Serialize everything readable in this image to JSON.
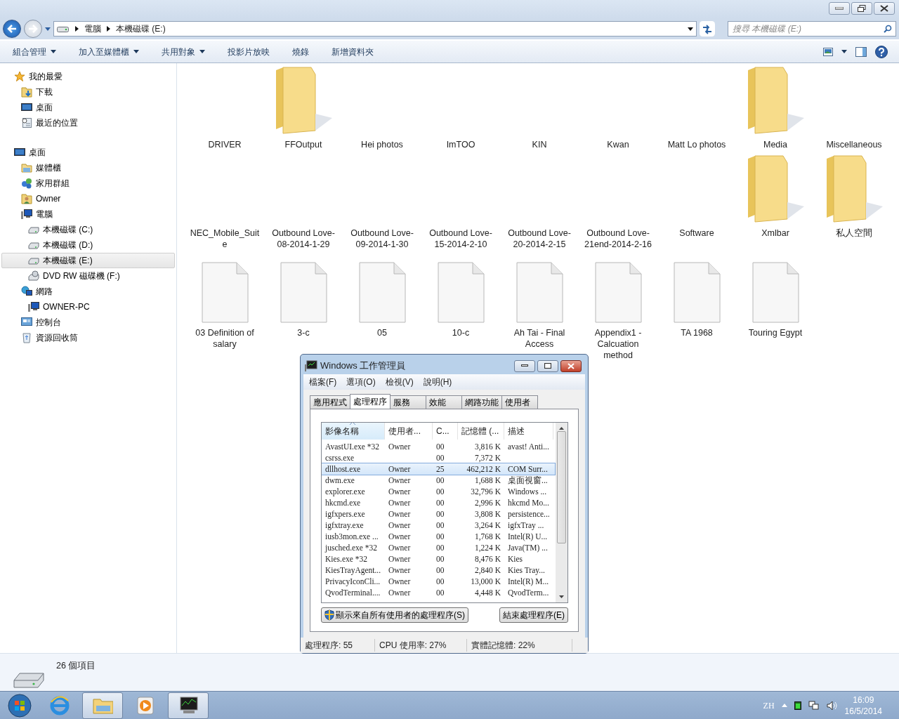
{
  "address_bar": {
    "path": [
      "電腦",
      "本機磁碟 (E:)"
    ]
  },
  "search": {
    "placeholder": "搜尋 本機磁碟 (E:)"
  },
  "toolbar": [
    {
      "label": "組合管理",
      "dropdown": true
    },
    {
      "label": "加入至媒體櫃",
      "dropdown": true
    },
    {
      "label": "共用對象",
      "dropdown": true
    },
    {
      "label": "投影片放映",
      "dropdown": false
    },
    {
      "label": "燒錄",
      "dropdown": false
    },
    {
      "label": "新增資料夾",
      "dropdown": false
    }
  ],
  "sidebar": {
    "items": [
      {
        "label": "我的最愛",
        "kind": "star",
        "selected": false,
        "children": [
          {
            "label": "下載",
            "kind": "download",
            "selected": false
          },
          {
            "label": "桌面",
            "kind": "desktop",
            "selected": false
          },
          {
            "label": "最近的位置",
            "kind": "recent",
            "selected": false
          }
        ]
      },
      {
        "label": "桌面",
        "kind": "desktop",
        "selected": false,
        "children": [
          {
            "label": "媒體櫃",
            "kind": "library",
            "selected": false
          },
          {
            "label": "家用群組",
            "kind": "homegroup",
            "selected": false
          },
          {
            "label": "Owner",
            "kind": "user",
            "selected": false
          },
          {
            "label": "電腦",
            "kind": "computer",
            "selected": false,
            "children": [
              {
                "label": "本機磁碟 (C:)",
                "kind": "drive",
                "selected": false
              },
              {
                "label": "本機磁碟 (D:)",
                "kind": "drive",
                "selected": false
              },
              {
                "label": "本機磁碟 (E:)",
                "kind": "drive",
                "selected": true
              },
              {
                "label": "DVD RW 磁碟機 (F:)",
                "kind": "dvd",
                "selected": false
              }
            ]
          },
          {
            "label": "網路",
            "kind": "network",
            "selected": false,
            "children": [
              {
                "label": "OWNER-PC",
                "kind": "computer",
                "selected": false
              }
            ]
          },
          {
            "label": "控制台",
            "kind": "control",
            "selected": false
          },
          {
            "label": "資源回收筒",
            "kind": "recycle",
            "selected": false
          }
        ]
      }
    ]
  },
  "files": [
    {
      "name": "DRIVER",
      "kind": "blank"
    },
    {
      "name": "FFOutput",
      "kind": "folder"
    },
    {
      "name": "Hei photos",
      "kind": "blank"
    },
    {
      "name": "ImTOO",
      "kind": "blank"
    },
    {
      "name": "KIN",
      "kind": "blank"
    },
    {
      "name": "Kwan",
      "kind": "blank"
    },
    {
      "name": "Matt Lo photos",
      "kind": "blank"
    },
    {
      "name": "Media",
      "kind": "folder"
    },
    {
      "name": "Miscellaneous",
      "kind": "blank"
    },
    {
      "name": "NEC_Mobile_Suite",
      "kind": "blank"
    },
    {
      "name": "Outbound Love-08-2014-1-29",
      "kind": "blank"
    },
    {
      "name": "Outbound Love-09-2014-1-30",
      "kind": "blank"
    },
    {
      "name": "Outbound Love-15-2014-2-10",
      "kind": "blank"
    },
    {
      "name": "Outbound Love-20-2014-2-15",
      "kind": "blank"
    },
    {
      "name": "Outbound Love-21end-2014-2-16",
      "kind": "blank"
    },
    {
      "name": "Software",
      "kind": "blank"
    },
    {
      "name": "Xmlbar",
      "kind": "folder"
    },
    {
      "name": "私人空間",
      "kind": "folder"
    },
    {
      "name": "03 Definition of salary",
      "kind": "file"
    },
    {
      "name": "3-c",
      "kind": "file"
    },
    {
      "name": "05",
      "kind": "file"
    },
    {
      "name": "10-c",
      "kind": "file"
    },
    {
      "name": "Ah Tai - Final Access",
      "kind": "file"
    },
    {
      "name": "Appendix1 - Calcuation method",
      "kind": "file"
    },
    {
      "name": "TA 1968",
      "kind": "file"
    },
    {
      "name": "Touring Egypt",
      "kind": "file"
    }
  ],
  "status_bar": {
    "count": "26 個項目"
  },
  "task_manager": {
    "title": "Windows 工作管理員",
    "menu": [
      "檔案(F)",
      "選項(O)",
      "檢視(V)",
      "說明(H)"
    ],
    "tabs": [
      {
        "label": "應用程式",
        "selected": false
      },
      {
        "label": "處理程序",
        "selected": true
      },
      {
        "label": "服務",
        "selected": false
      },
      {
        "label": "效能",
        "selected": false
      },
      {
        "label": "網路功能",
        "selected": false
      },
      {
        "label": "使用者",
        "selected": false
      }
    ],
    "columns": [
      {
        "label": "影像名稱",
        "sorted": true
      },
      {
        "label": "使用者...",
        "sorted": false
      },
      {
        "label": "C...",
        "sorted": false
      },
      {
        "label": "記憶體 (...",
        "sorted": false
      },
      {
        "label": "描述",
        "sorted": false
      }
    ],
    "rows": [
      {
        "cells": [
          "AvastUI.exe *32",
          "Owner",
          "00",
          "3,816 K",
          "avast! Anti..."
        ],
        "selected": false
      },
      {
        "cells": [
          "csrss.exe",
          "",
          "00",
          "7,372 K",
          ""
        ],
        "selected": false
      },
      {
        "cells": [
          "dllhost.exe",
          "Owner",
          "25",
          "462,212 K",
          "COM Surr..."
        ],
        "selected": true
      },
      {
        "cells": [
          "dwm.exe",
          "Owner",
          "00",
          "1,688 K",
          "桌面視窗..."
        ],
        "selected": false
      },
      {
        "cells": [
          "explorer.exe",
          "Owner",
          "00",
          "32,796 K",
          "Windows ..."
        ],
        "selected": false
      },
      {
        "cells": [
          "hkcmd.exe",
          "Owner",
          "00",
          "2,996 K",
          "hkcmd Mo..."
        ],
        "selected": false
      },
      {
        "cells": [
          "igfxpers.exe",
          "Owner",
          "00",
          "3,808 K",
          "persistence..."
        ],
        "selected": false
      },
      {
        "cells": [
          "igfxtray.exe",
          "Owner",
          "00",
          "3,264 K",
          "igfxTray ..."
        ],
        "selected": false
      },
      {
        "cells": [
          "iusb3mon.exe ...",
          "Owner",
          "00",
          "1,768 K",
          "Intel(R) U..."
        ],
        "selected": false
      },
      {
        "cells": [
          "jusched.exe *32",
          "Owner",
          "00",
          "1,224 K",
          "Java(TM) ..."
        ],
        "selected": false
      },
      {
        "cells": [
          "Kies.exe *32",
          "Owner",
          "00",
          "8,476 K",
          "Kies"
        ],
        "selected": false
      },
      {
        "cells": [
          "KiesTrayAgent...",
          "Owner",
          "00",
          "2,840 K",
          "Kies Tray..."
        ],
        "selected": false
      },
      {
        "cells": [
          "PrivacyIconCli...",
          "Owner",
          "00",
          "13,000 K",
          "Intel(R) M..."
        ],
        "selected": false
      },
      {
        "cells": [
          "QvodTerminal....",
          "Owner",
          "00",
          "4,448 K",
          "QvodTerm..."
        ],
        "selected": false
      }
    ],
    "buttons": [
      {
        "label": "顯示來自所有使用者的處理程序(S)",
        "shield": true
      },
      {
        "label": "結束處理程序(E)",
        "shield": false
      }
    ],
    "status": [
      "處理程序: 55",
      "CPU 使用率: 27%",
      "實體記憶體: 22%"
    ]
  },
  "taskbar": {
    "apps": [
      {
        "kind": "browser",
        "active": false
      },
      {
        "kind": "explorer",
        "active": true
      },
      {
        "kind": "media",
        "active": false
      },
      {
        "kind": "taskmgr",
        "active": true
      }
    ],
    "language": "ZH",
    "time": "16:09",
    "date": "16/5/2014"
  }
}
